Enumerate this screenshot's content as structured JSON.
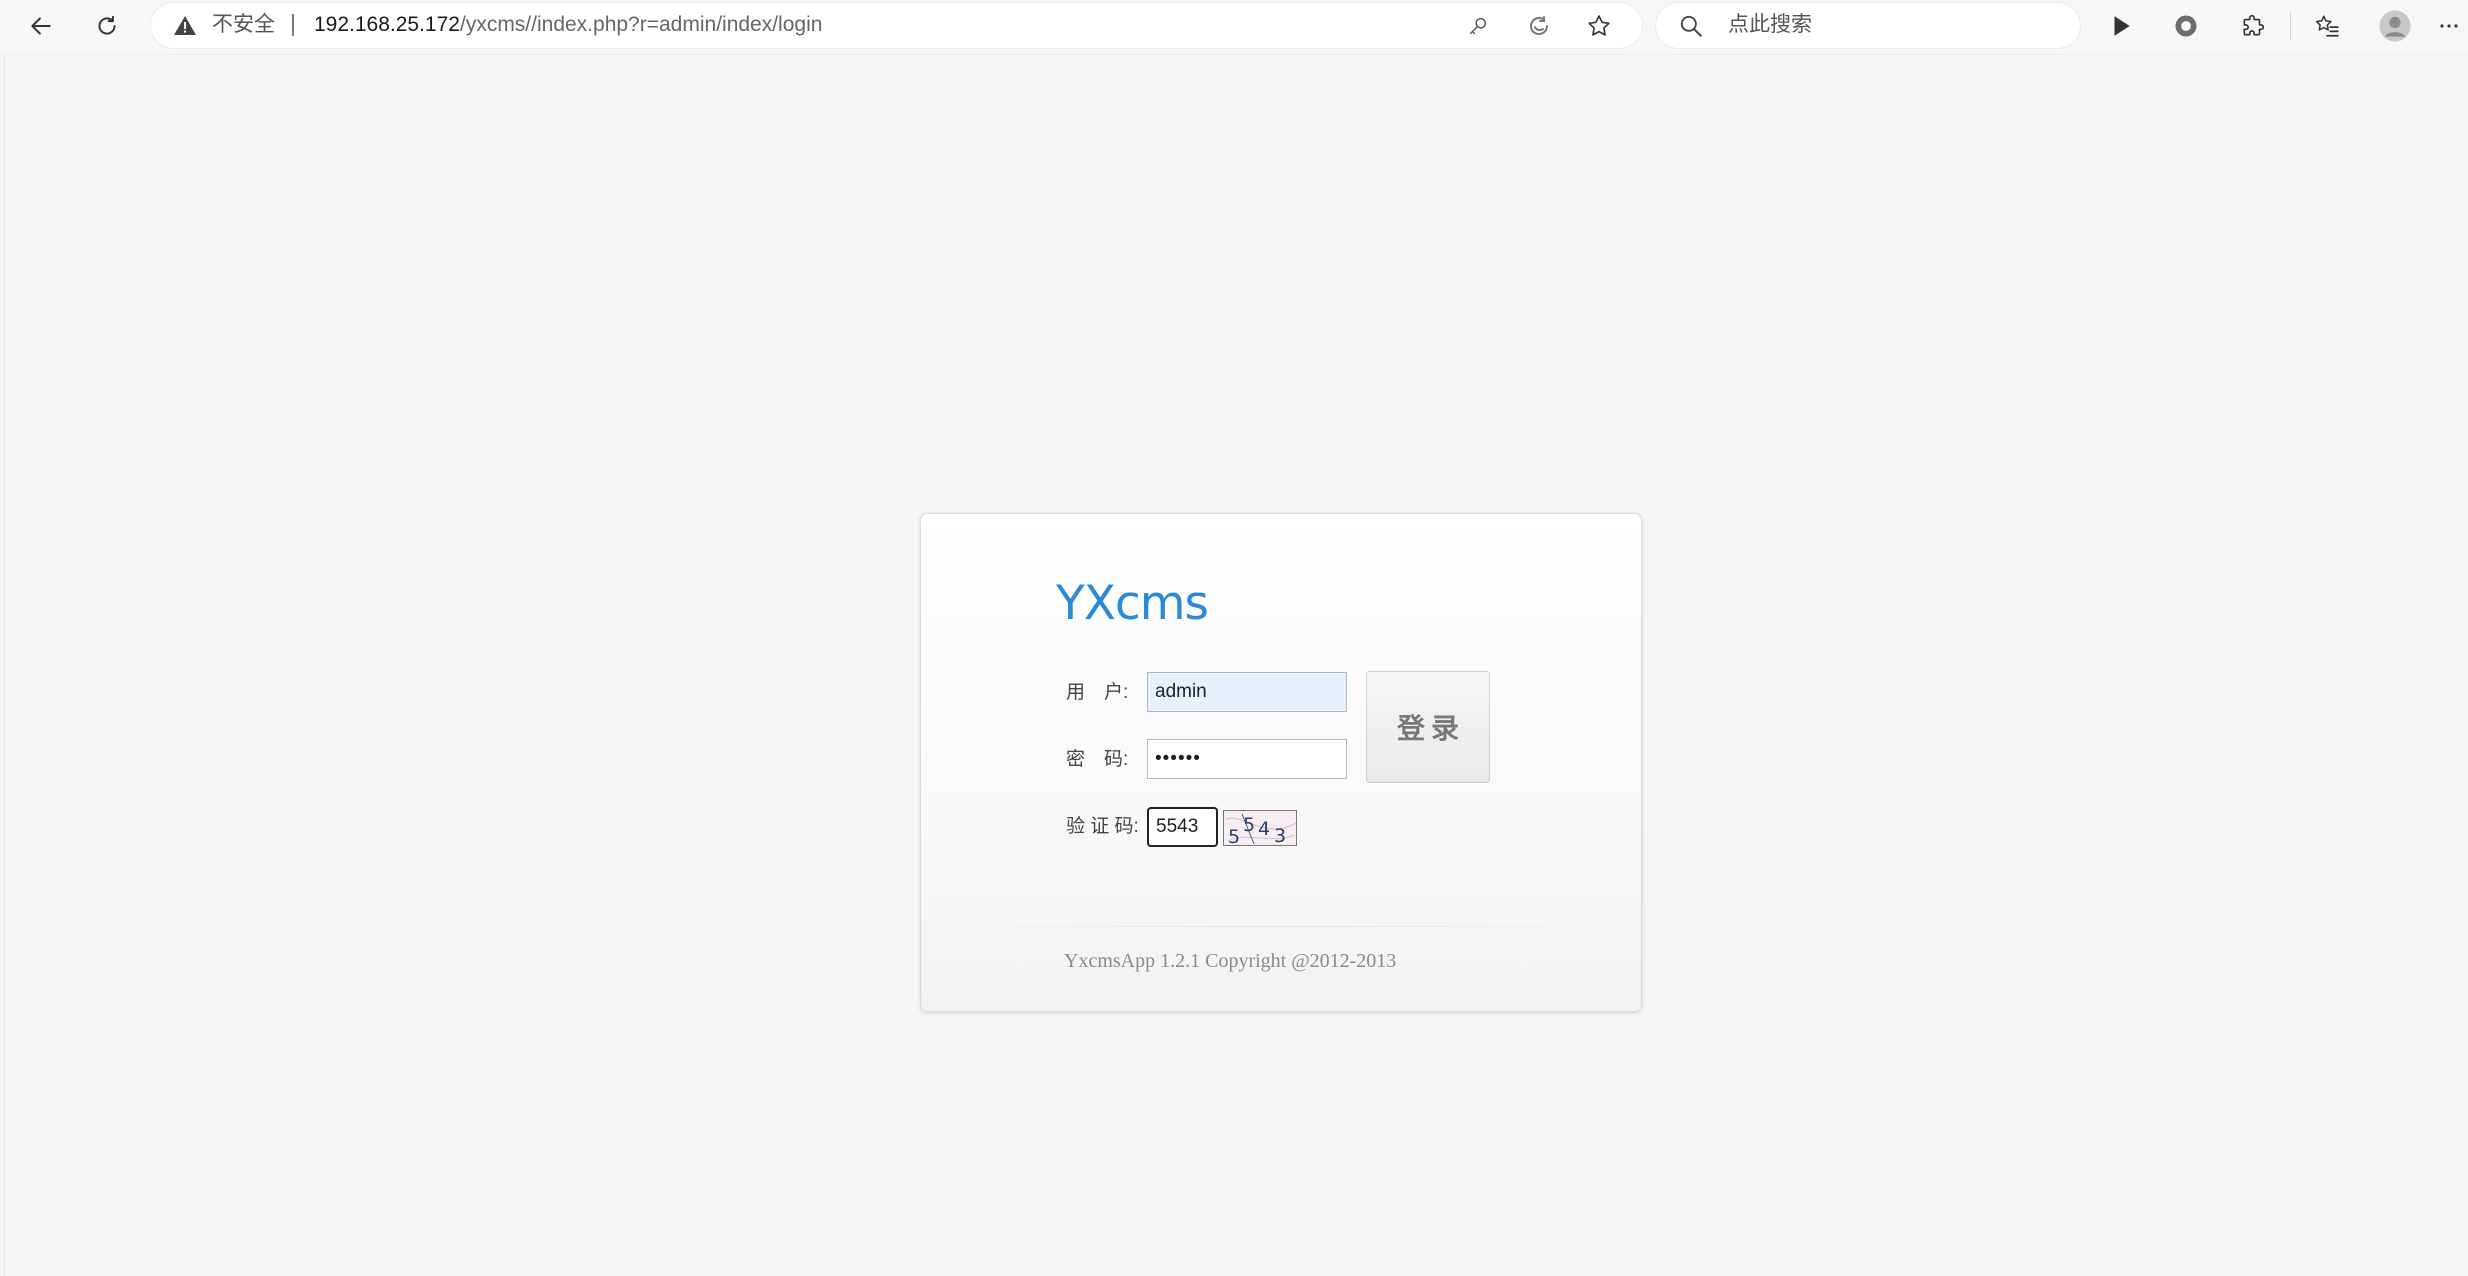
{
  "browser": {
    "address": {
      "security_label": "不安全",
      "url_host": "192.168.25.172",
      "url_path": "/yxcms//index.php?r=admin/index/login"
    },
    "search": {
      "placeholder": "点此搜索"
    },
    "icons": {
      "back": "arrow-left-icon",
      "refresh": "refresh-icon",
      "warning": "warning-triangle-icon",
      "password_key": "key-icon",
      "edge_refresh": "edge-icon",
      "favorite": "star-icon",
      "search": "search-icon",
      "play": "play-icon",
      "record": "record-icon",
      "extensions": "puzzle-icon",
      "favorites": "favorites-icon",
      "profile": "profile-icon",
      "more": "more-icon"
    }
  },
  "login": {
    "logo": "YXcms",
    "username_label": "用　户:",
    "username_value": "admin",
    "password_label": "密　码:",
    "password_value": "••••••",
    "captcha_label": "验 证 码:",
    "captcha_value": "5543",
    "captcha_image_text": "5543",
    "submit_label": "登录",
    "footer": "YxcmsApp 1.2.1 Copyright @2012-2013"
  },
  "colors": {
    "logo_blue": "#2a8ad8",
    "autofill_blue": "#e8f0fe",
    "page_bg": "#f5f5f5"
  }
}
